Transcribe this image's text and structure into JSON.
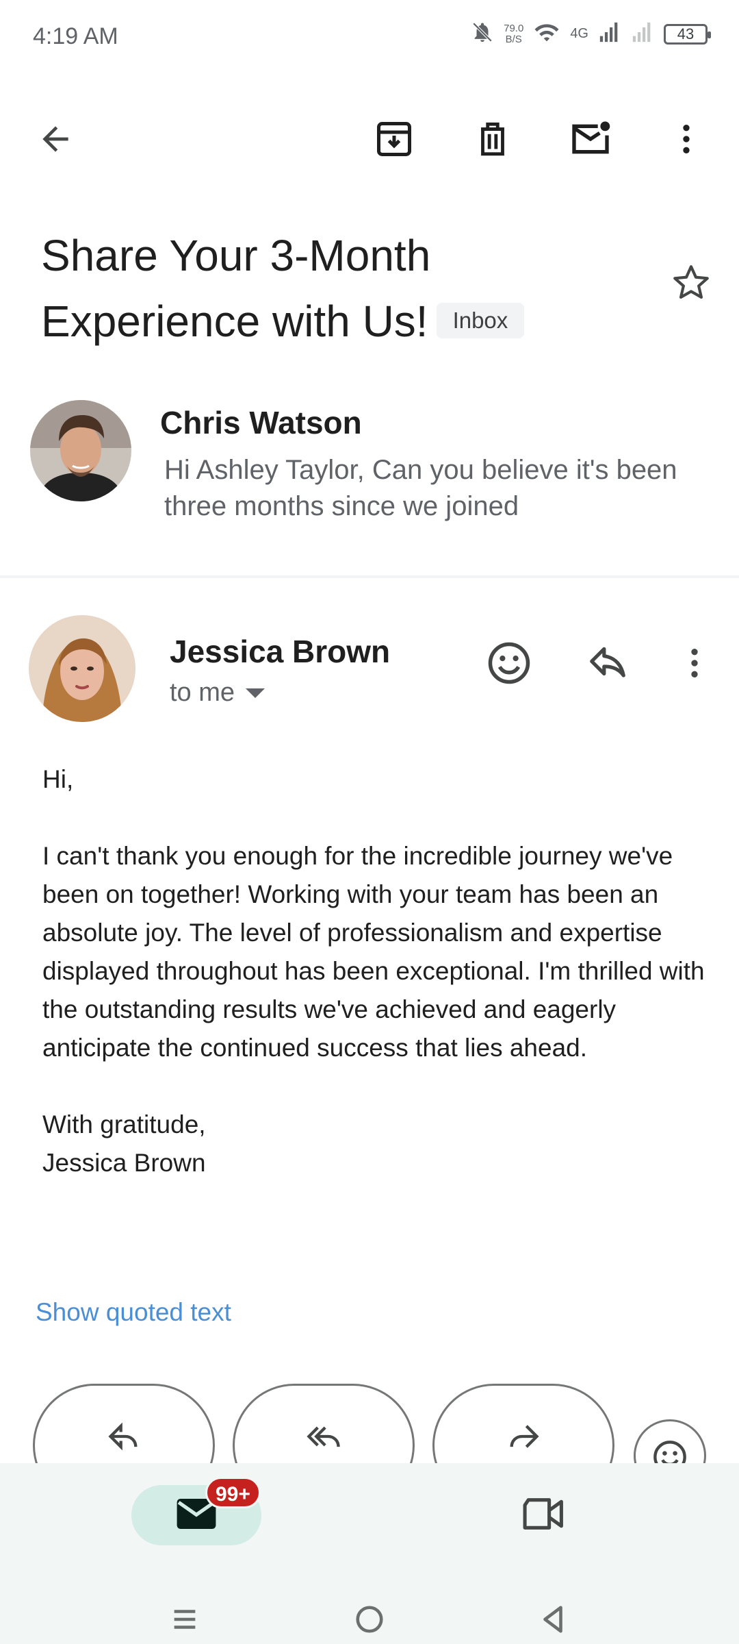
{
  "status_bar": {
    "time": "4:19 AM",
    "net_speed_value": "79.0",
    "net_speed_unit": "B/S",
    "network_type": "4G",
    "battery": "43"
  },
  "toolbar": {
    "back_icon": "arrow-back-icon",
    "archive_icon": "archive-icon",
    "delete_icon": "trash-icon",
    "mark_unread_icon": "mail-unread-icon",
    "more_icon": "more-vert-icon"
  },
  "subject": {
    "text": "Share Your 3-Month Experience with Us!",
    "label": "Inbox"
  },
  "collapsed_message": {
    "sender": "Chris Watson",
    "snippet": "Hi Ashley Taylor, Can you believe it's been three months since we joined"
  },
  "expanded_message": {
    "sender": "Jessica Brown",
    "recipient_text": "to me",
    "body": {
      "greeting": "Hi,",
      "paragraph": "I can't thank you enough for the incredible journey we've been on together! Working with your team has been an absolute joy. The level of professionalism and expertise displayed throughout has been exceptional. I'm thrilled with the outstanding results we've achieved and eagerly anticipate the continued success that lies ahead.",
      "closing": "With gratitude,",
      "signature": "Jessica Brown"
    },
    "show_quoted": "Show quoted text"
  },
  "bottom_nav": {
    "mail_badge": "99+"
  },
  "colors": {
    "link": "#4a8fd6",
    "badge": "#c5221f",
    "nav_active": "#d3ece6",
    "nav_bg": "#f2f6f5"
  }
}
